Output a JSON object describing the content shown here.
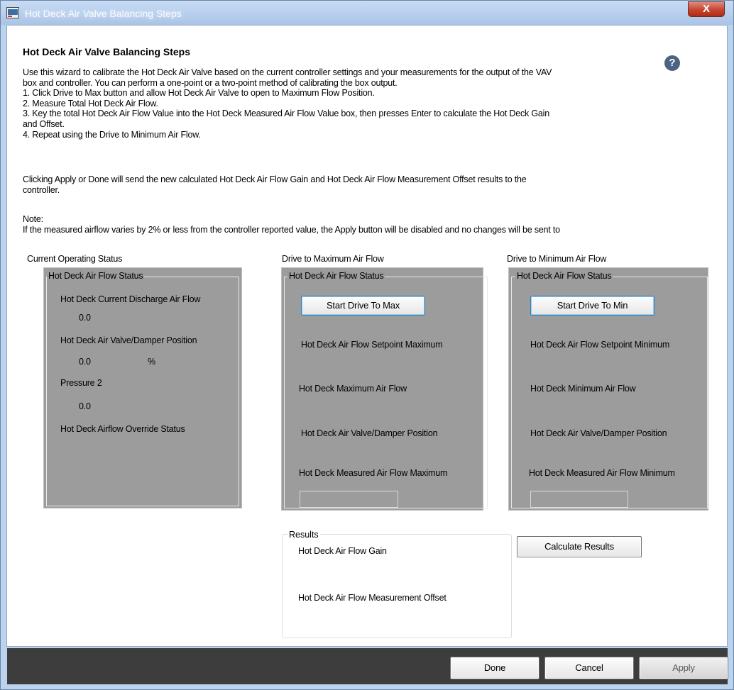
{
  "window": {
    "title": "Hot Deck Air Valve Balancing Steps",
    "close_label": "X"
  },
  "heading": "Hot Deck Air Valve Balancing Steps",
  "help_label": "?",
  "intro_lines": [
    "Use this wizard to calibrate the Hot Deck Air Valve based on the current controller settings and your measurements for the output of the VAV",
    "box and controller. You can perform a one-point or a two-point method of calibrating the box output.",
    "1. Click Drive to Max button and allow Hot Deck Air Valve to open to Maximum Flow Position.",
    "2. Measure Total Hot Deck Air Flow.",
    "3. Key the total Hot Deck Air Flow Value into the Hot Deck Measured Air Flow Value box, then presses Enter to calculate the Hot Deck Gain",
    "and Offset.",
    "4. Repeat using the Drive to Minimum Air Flow."
  ],
  "apply_note_lines": [
    "Clicking Apply or Done will send the new calculated Hot Deck Air Flow Gain and Hot Deck Air Flow Measurement Offset results to the",
    "controller."
  ],
  "note": {
    "title": "Note:",
    "text": "If the measured airflow varies by 2% or less from the controller reported value, the Apply button will be disabled and no changes will be sent to"
  },
  "current_status": {
    "section_label": "Current Operating Status",
    "group_label": "Hot Deck Air Flow Status",
    "discharge_label": "Hot Deck Current Discharge Air Flow",
    "discharge_value": "0.0",
    "damper_label": "Hot Deck Air Valve/Damper Position",
    "damper_value": "0.0",
    "damper_unit": "%",
    "pressure_label": "Pressure 2",
    "pressure_value": "0.0",
    "override_label": "Hot Deck Airflow Override Status"
  },
  "drive_max": {
    "section_label": "Drive to Maximum Air Flow",
    "group_label": "Hot Deck Air Flow Status",
    "button_label": "Start Drive To Max",
    "setpoint_label": "Hot Deck Air Flow Setpoint Maximum",
    "airflow_label": "Hot Deck Maximum Air Flow",
    "damper_label": "Hot Deck Air Valve/Damper Position",
    "measured_label": "Hot Deck Measured Air Flow Maximum",
    "measured_value": ""
  },
  "drive_min": {
    "section_label": "Drive to Minimum Air Flow",
    "group_label": "Hot Deck Air Flow Status",
    "button_label": "Start Drive To Min",
    "setpoint_label": "Hot Deck Air Flow Setpoint Minimum",
    "airflow_label": "Hot Deck Minimum Air Flow",
    "damper_label": "Hot Deck Air Valve/Damper Position",
    "measured_label": "Hot Deck Measured Air Flow Minimum",
    "measured_value": ""
  },
  "results": {
    "group_label": "Results",
    "gain_label": "Hot Deck Air Flow Gain",
    "offset_label": "Hot Deck Air Flow Measurement Offset",
    "calculate_label": "Calculate Results"
  },
  "footer": {
    "done_label": "Done",
    "cancel_label": "Cancel",
    "apply_label": "Apply"
  }
}
